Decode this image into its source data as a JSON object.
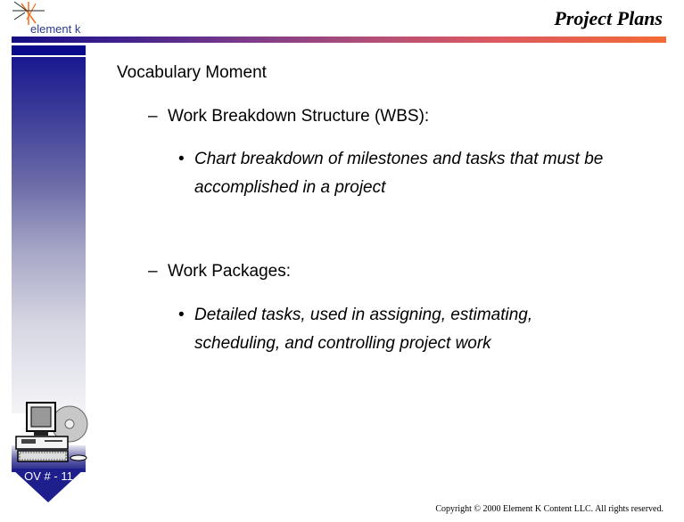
{
  "header": {
    "logo_text": "element k",
    "title": "Project Plans"
  },
  "brand_colors": {
    "navy": "#0c0a8c",
    "orange": "#f36a35"
  },
  "sidebar": {
    "slide_label": "OV # - 11"
  },
  "content": {
    "heading": "Vocabulary Moment",
    "sections": [
      {
        "dash": "–",
        "term": "Work Breakdown Structure (WBS):",
        "bullet": "•",
        "definition_line1": "Chart breakdown of milestones and tasks that must be",
        "definition_line2": "accomplished in a project"
      },
      {
        "dash": "–",
        "term": "Work Packages:",
        "bullet": "•",
        "definition_line1": "Detailed tasks, used in assigning, estimating,",
        "definition_line2": "scheduling, and controlling project work"
      }
    ]
  },
  "footer": {
    "copyright": "Copyright © 2000 Element K Content LLC. All rights reserved."
  }
}
